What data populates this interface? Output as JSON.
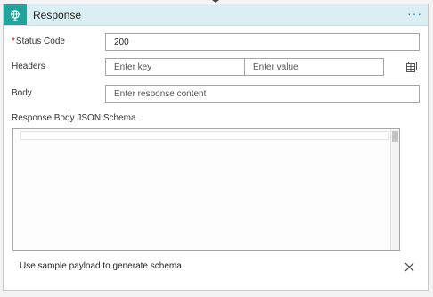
{
  "header": {
    "title": "Response",
    "more_label": "···",
    "icon": "globe-response-icon",
    "accent_color": "#1fa59c",
    "background_color": "#dbeef3"
  },
  "status_code": {
    "required_mark": "*",
    "label": "Status Code",
    "value": "200"
  },
  "headers": {
    "label": "Headers",
    "key_placeholder": "Enter key",
    "value_placeholder": "Enter value",
    "toggle_icon": "table-mode-icon"
  },
  "body": {
    "label": "Body",
    "placeholder": "Enter response content"
  },
  "schema": {
    "label": "Response Body JSON Schema"
  },
  "footer": {
    "sample_payload_link": "Use sample payload to generate schema",
    "close_icon": "close-icon"
  }
}
